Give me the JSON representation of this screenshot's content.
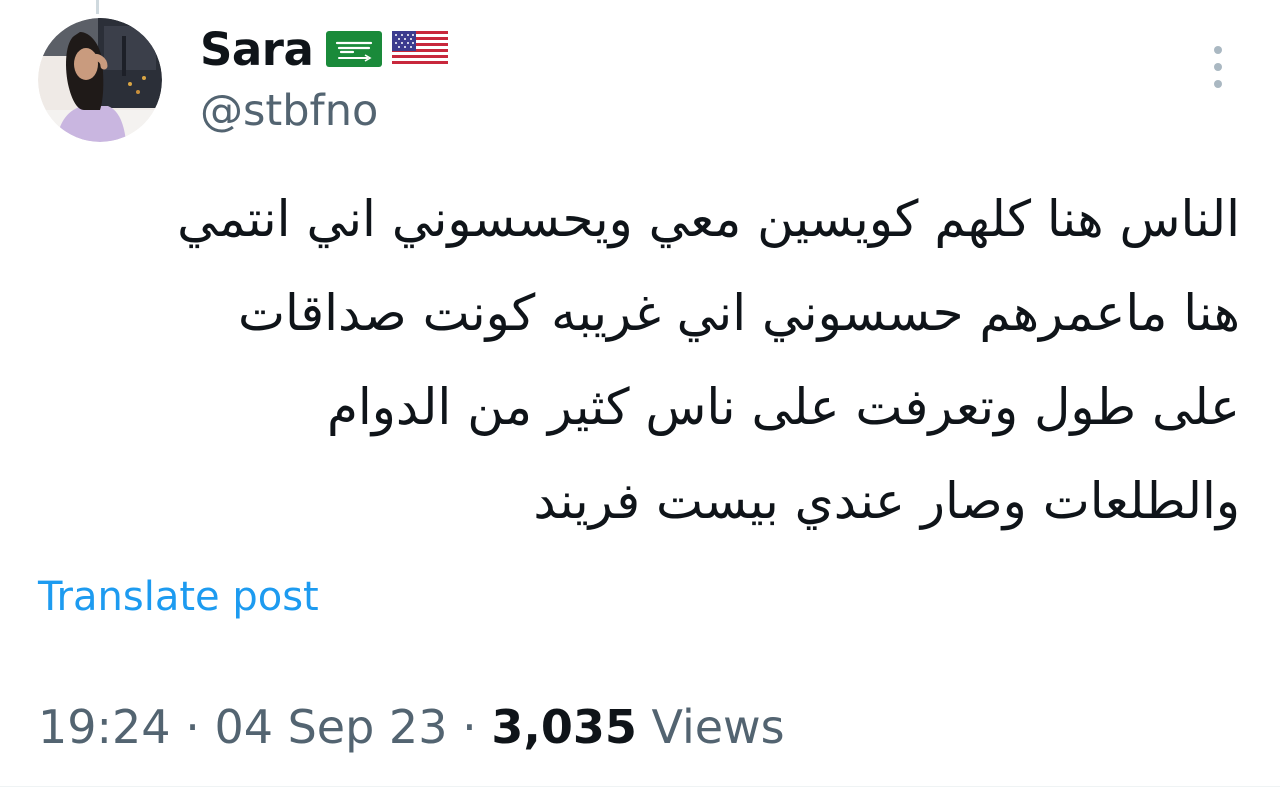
{
  "author": {
    "name": "Sara",
    "handle": "@stbfno",
    "flags": [
      "saudi-arabia-flag",
      "united-states-flag"
    ]
  },
  "tweet": {
    "lines": [
      "الناس هنا كلهم كويسين معي ويحسسوني اني انتمي",
      "هنا ماعمرهم حسسوني اني غريبه كونت صداقات",
      "على طول وتعرفت على ناس كثير من الدوام",
      "والطلعات وصار عندي بيست فريند"
    ],
    "translate_label": "Translate post"
  },
  "meta": {
    "time": "19:24",
    "date": "04 Sep 23",
    "separator": "·",
    "views_count": "3,035",
    "views_label": "Views"
  },
  "colors": {
    "text_primary": "#0f1419",
    "text_secondary": "#536471",
    "accent": "#1d9bf0"
  },
  "icons": {
    "more": "more-vertical-icon"
  }
}
